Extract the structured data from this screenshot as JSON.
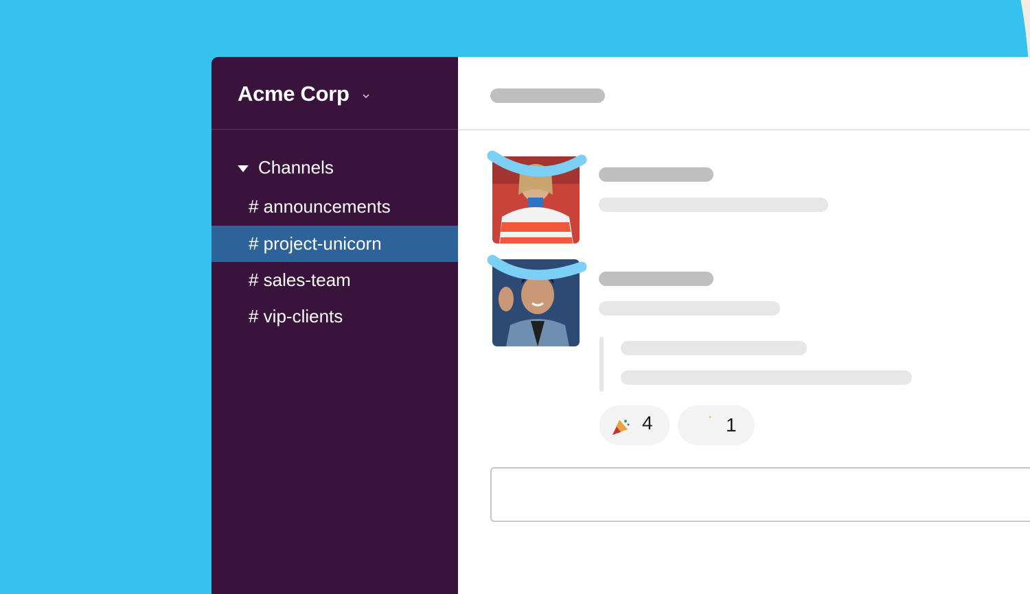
{
  "colors": {
    "background_blue": "#36c2ec",
    "background_beige": "#f2ece3",
    "sidebar": "#3a133c",
    "active_channel": "#2e6399",
    "highlight_stroke": "#7ccff5"
  },
  "workspace": {
    "name": "Acme Corp",
    "chevron_icon": "chevron-down-icon"
  },
  "sidebar": {
    "section_label": "Channels",
    "channels": [
      {
        "label": "# announcements",
        "active": false
      },
      {
        "label": "# project-unicorn",
        "active": true
      },
      {
        "label": "# sales-team",
        "active": false
      },
      {
        "label": "# vip-clients",
        "active": false
      }
    ]
  },
  "messages": [
    {
      "avatar": "avatar-woman-striped-sweater"
    },
    {
      "avatar": "avatar-man-waving"
    }
  ],
  "reactions": [
    {
      "icon": "party-popper-icon",
      "count": "4"
    },
    {
      "icon": "sparkle-icon",
      "count": "1"
    }
  ]
}
